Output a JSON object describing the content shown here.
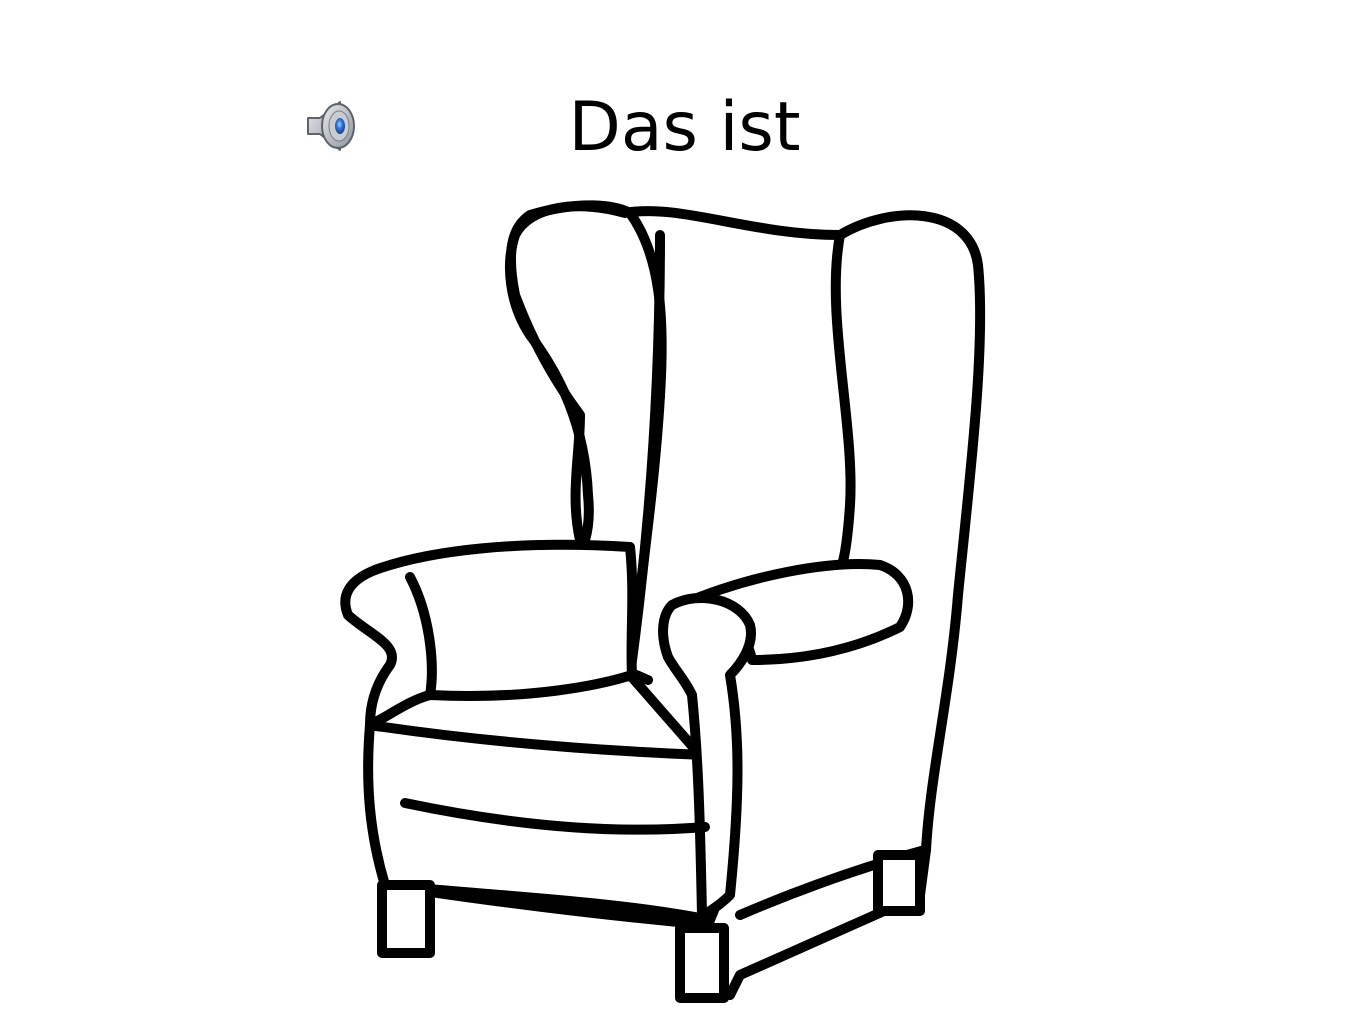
{
  "slide": {
    "title": "Das ist",
    "audio_icon": "speaker-icon",
    "illustration": "armchair-icon"
  },
  "colors": {
    "background": "#ffffff",
    "text": "#000000",
    "speaker_blue": "#2f6fd6",
    "speaker_gray": "#8a8f96"
  }
}
